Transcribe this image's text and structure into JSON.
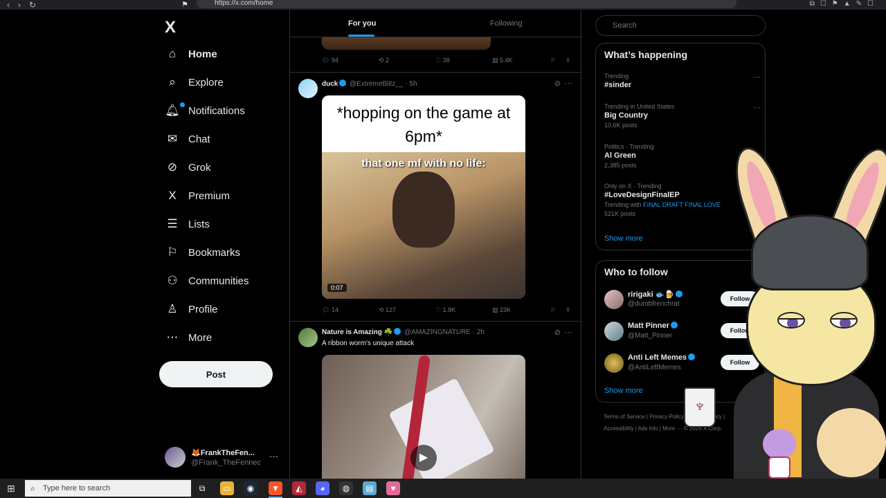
{
  "browser": {
    "url": "https://x.com/home"
  },
  "nav": {
    "logo": "X",
    "items": [
      {
        "label": "Home",
        "icon": "home-icon",
        "glyph": "⌂",
        "active": true
      },
      {
        "label": "Explore",
        "icon": "search-icon",
        "glyph": "⌕"
      },
      {
        "label": "Notifications",
        "icon": "bell-icon",
        "glyph": "🔔︎"
      },
      {
        "label": "Chat",
        "icon": "mail-icon",
        "glyph": "✉"
      },
      {
        "label": "Grok",
        "icon": "grok-icon",
        "glyph": "⊘"
      },
      {
        "label": "Premium",
        "icon": "x-logo-icon",
        "glyph": "X"
      },
      {
        "label": "Lists",
        "icon": "list-icon",
        "glyph": "☰"
      },
      {
        "label": "Bookmarks",
        "icon": "bookmark-icon",
        "glyph": "⚐"
      },
      {
        "label": "Communities",
        "icon": "communities-icon",
        "glyph": "⚇"
      },
      {
        "label": "Profile",
        "icon": "person-icon",
        "glyph": "♙"
      },
      {
        "label": "More",
        "icon": "more-circle-icon",
        "glyph": "⋯"
      }
    ],
    "post_label": "Post",
    "account": {
      "name": "🦊FrankTheFen...",
      "handle": "@Frank_TheFennec",
      "more": "···"
    }
  },
  "timeline": {
    "tabs": {
      "for_you": "For you",
      "following": "Following"
    },
    "prev_actions": {
      "replies": "94",
      "reposts": "2",
      "likes": "38",
      "views": "5.4K"
    },
    "tweet1": {
      "name": "duck",
      "handle": "@ExtremeBlitz__",
      "time": "· 5h",
      "caption": "*hopping on the game at 6pm*",
      "subcaption": "that one mf with no life:",
      "duration": "0:07",
      "replies": "14",
      "reposts": "127",
      "likes": "1.8K",
      "views": "23K"
    },
    "tweet2": {
      "name": "Nature is Amazing ☘️",
      "handle": "@AMAZINGNATURE",
      "time": "· 2h",
      "text": "A ribbon worm's unique attack"
    }
  },
  "sidebar": {
    "search_placeholder": "Search",
    "happening_title": "What’s happening",
    "trends": [
      {
        "context": "Trending",
        "title": "#sinder"
      },
      {
        "context": "Trending in United States",
        "title": "Big Country",
        "count": "10.6K posts"
      },
      {
        "context": "Politics · Trending",
        "title": "Al Green",
        "count": "2,385 posts"
      },
      {
        "context": "Only on X · Trending",
        "title": "#LoveDesignFinalEP",
        "with_label": "Trending with",
        "with_tags": "FINAL DRAFT FINAL LOVE",
        "count": "521K posts"
      }
    ],
    "show_more": "Show more",
    "wtf_title": "Who to follow",
    "wtf": [
      {
        "name": "ririgaki 🐟🍺",
        "handle": "@dumbfrenchrat",
        "follow": "Follow"
      },
      {
        "name": "Matt Pinner",
        "handle": "@Matt_Pinner",
        "follow": "Follow"
      },
      {
        "name": "Anti Left Memes",
        "handle": "@AntiLeftMemes",
        "follow": "Follow"
      }
    ],
    "footer1": "Terms of Service  |  Privacy Policy  |  Cookie Policy  |",
    "footer2": "Accessibility  |  Ads info  |  More ···  © 2025 X Corp."
  },
  "taskbar": {
    "search_placeholder": "Type here to search"
  },
  "colors": {
    "accent": "#1d9bf0",
    "background": "#000000",
    "border": "#2f3336",
    "muted": "#71767b"
  }
}
